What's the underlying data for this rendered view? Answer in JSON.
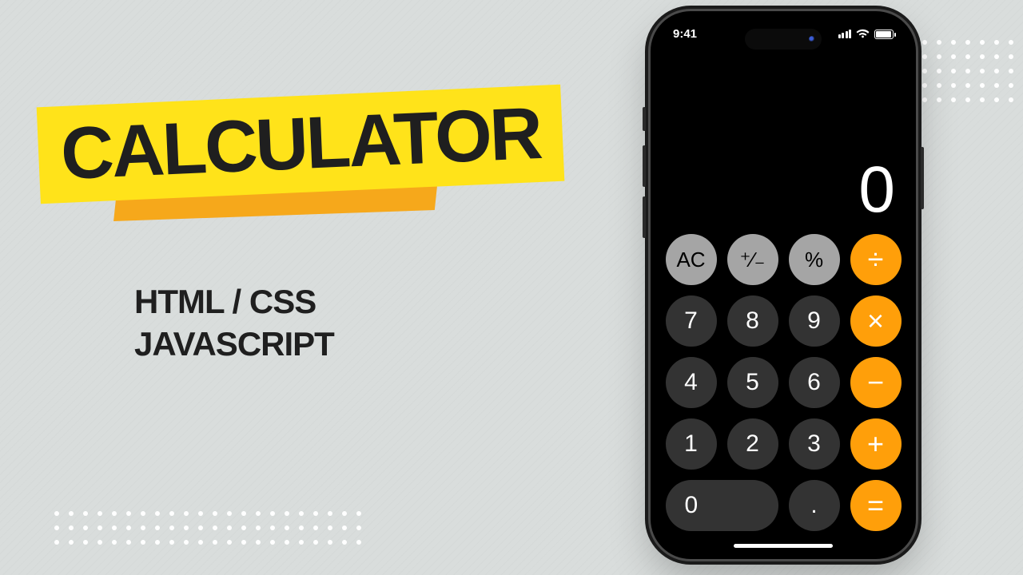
{
  "title": "CALCULATOR",
  "subtitle_line1": "HTML / CSS",
  "subtitle_line2": "JAVASCRIPT",
  "phone": {
    "status": {
      "time": "9:41"
    },
    "display_value": "0",
    "keys": {
      "ac": "AC",
      "sign": "⁺∕₋",
      "percent": "%",
      "divide": "÷",
      "k7": "7",
      "k8": "8",
      "k9": "9",
      "multiply": "×",
      "k4": "4",
      "k5": "5",
      "k6": "6",
      "minus": "−",
      "k1": "1",
      "k2": "2",
      "k3": "3",
      "plus": "+",
      "k0": "0",
      "dot": ".",
      "equals": "="
    }
  },
  "decor": {
    "top_right_dots": 40,
    "bottom_left_dots": 66
  }
}
